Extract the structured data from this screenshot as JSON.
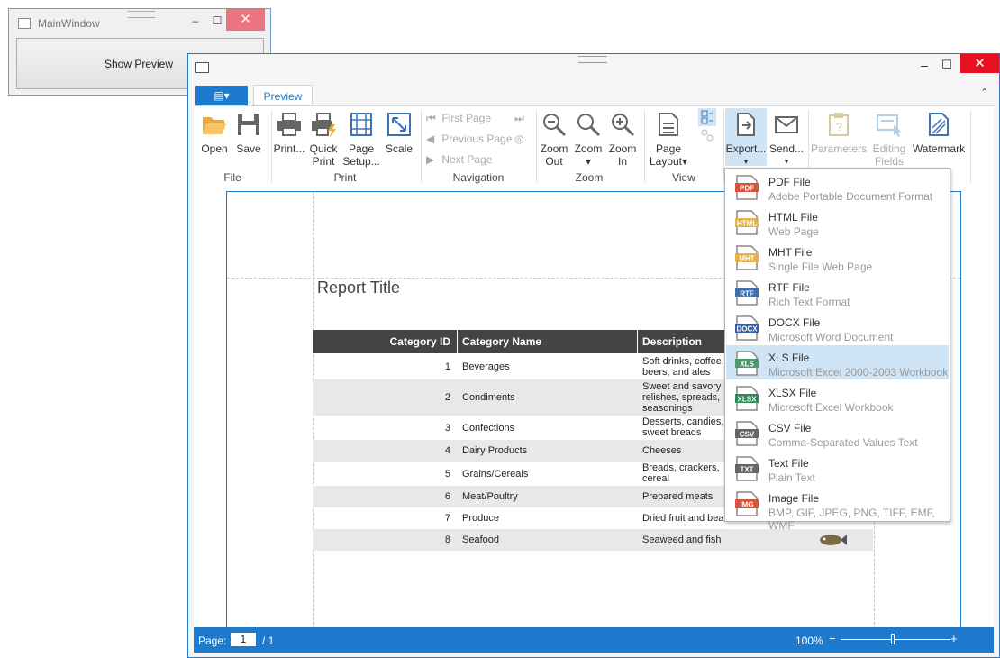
{
  "main_window": {
    "title": "MainWindow",
    "button_label": "Show Preview",
    "minimize": "–",
    "maximize": "☐",
    "close": "✕"
  },
  "preview_window": {
    "minimize": "–",
    "maximize": "☐",
    "close": "✕",
    "app_menu_label": "▤▾",
    "tab_label": "Preview",
    "collapse": "⌃",
    "ribbon": {
      "file": {
        "open": "Open",
        "save": "Save",
        "group": "File"
      },
      "print": {
        "print": "Print...",
        "quick_print_1": "Quick",
        "quick_print_2": "Print",
        "page_setup_1": "Page",
        "page_setup_2": "Setup...",
        "scale": "Scale",
        "group": "Print"
      },
      "navigation": {
        "first": "First Page",
        "previous": "Previous Page",
        "next": "Next Page",
        "group": "Navigation"
      },
      "zoom": {
        "zoom_out_1": "Zoom",
        "zoom_out_2": "Out",
        "zoom_1": "Zoom",
        "zoom_2": "▾",
        "zoom_in_1": "Zoom",
        "zoom_in_2": "In",
        "group": "Zoom"
      },
      "view": {
        "page_layout_1": "Page",
        "page_layout_2": "Layout▾",
        "group": "View"
      },
      "export": {
        "export": "Export...",
        "export_arrow": "▾",
        "send": "Send...",
        "send_arrow": "▾"
      },
      "params": {
        "parameters": "Parameters",
        "editing_1": "Editing",
        "editing_2": "Fields",
        "watermark": "Watermark"
      }
    },
    "report": {
      "title": "Report Title",
      "columns": [
        "Category ID",
        "Category Name",
        "Description"
      ],
      "rows": [
        {
          "id": "1",
          "name": "Beverages",
          "desc": "Soft drinks, coffee, beers, and ales"
        },
        {
          "id": "2",
          "name": "Condiments",
          "desc": "Sweet and savory relishes, spreads, seasonings"
        },
        {
          "id": "3",
          "name": "Confections",
          "desc": "Desserts, candies, sweet breads"
        },
        {
          "id": "4",
          "name": "Dairy Products",
          "desc": "Cheeses"
        },
        {
          "id": "5",
          "name": "Grains/Cereals",
          "desc": "Breads, crackers, cereal"
        },
        {
          "id": "6",
          "name": "Meat/Poultry",
          "desc": "Prepared meats"
        },
        {
          "id": "7",
          "name": "Produce",
          "desc": "Dried fruit and bean"
        },
        {
          "id": "8",
          "name": "Seafood",
          "desc": "Seaweed and fish"
        }
      ]
    },
    "status": {
      "page_label": "Page:",
      "page_value": "1",
      "page_total": "/ 1",
      "zoom": "100%",
      "zoom_minus": "−",
      "zoom_plus": "+",
      "zoom_level_pct": 50
    }
  },
  "export_menu": [
    {
      "badge": "PDF",
      "badge_color": "#d9543b",
      "title": "PDF File",
      "subtitle": "Adobe Portable Document Format"
    },
    {
      "badge": "HTML",
      "badge_color": "#e8b24a",
      "title": "HTML File",
      "subtitle": "Web Page"
    },
    {
      "badge": "MHT",
      "badge_color": "#e8b24a",
      "title": "MHT File",
      "subtitle": "Single File Web Page"
    },
    {
      "badge": "RTF",
      "badge_color": "#3d6fb3",
      "title": "RTF File",
      "subtitle": "Rich Text Format"
    },
    {
      "badge": "DOCX",
      "badge_color": "#2f5fa8",
      "title": "DOCX File",
      "subtitle": "Microsoft Word Document"
    },
    {
      "badge": "XLS",
      "badge_color": "#4c9a6a",
      "title": "XLS File",
      "subtitle": "Microsoft Excel 2000-2003 Workbook",
      "highlight": true
    },
    {
      "badge": "XLSX",
      "badge_color": "#2f8a5a",
      "title": "XLSX File",
      "subtitle": "Microsoft Excel Workbook"
    },
    {
      "badge": "CSV",
      "badge_color": "#666666",
      "title": "CSV File",
      "subtitle": "Comma-Separated Values Text"
    },
    {
      "badge": "TXT",
      "badge_color": "#666666",
      "title": "Text File",
      "subtitle": "Plain Text"
    },
    {
      "badge": "IMG",
      "badge_color": "#d9543b",
      "title": "Image File",
      "subtitle": "BMP, GIF, JPEG, PNG, TIFF, EMF, WMF"
    }
  ]
}
